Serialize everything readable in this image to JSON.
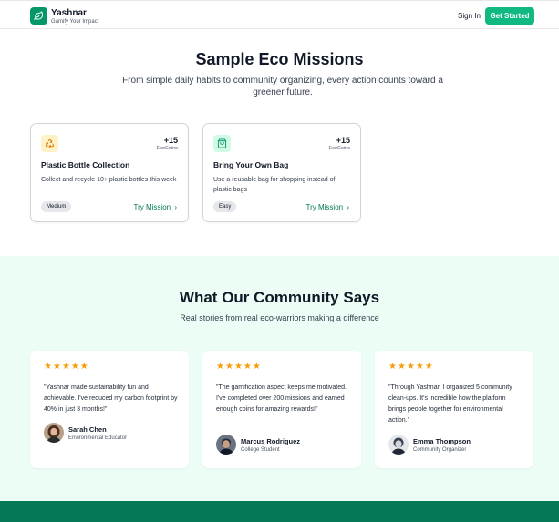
{
  "header": {
    "brand": "Yashnar",
    "tagline": "Gamify Your Impact",
    "sign_in": "Sign In",
    "get_started": "Get Started"
  },
  "missions": {
    "title": "Sample Eco Missions",
    "subtitle": "From simple daily habits to community organizing, every action counts toward a greener future.",
    "cards": [
      {
        "icon": "recycle-icon",
        "icon_bg": "#fef3c7",
        "icon_color": "#d97706",
        "points": "+15",
        "points_unit": "EcoCoins",
        "title": "Plastic Bottle Collection",
        "description": "Collect and recycle 10+ plastic bottles this week",
        "difficulty": "Medium",
        "cta": "Try Mission"
      },
      {
        "icon": "shopping-bag-icon",
        "icon_bg": "#d1fae5",
        "icon_color": "#059669",
        "points": "+15",
        "points_unit": "EcoCoins",
        "title": "Bring Your Own Bag",
        "description": "Use a reusable bag for shopping instead of plastic bags",
        "difficulty": "Easy",
        "cta": "Try Mission"
      }
    ]
  },
  "community": {
    "title": "What Our Community Says",
    "subtitle": "Real stories from real eco-warriors making a difference",
    "rating": 5,
    "testimonials": [
      {
        "quote": "\"Yashnar made sustainability fun and achievable. I've reduced my carbon footprint by 40% in just 3 months!\"",
        "name": "Sarah Chen",
        "role": "Environmental Educator"
      },
      {
        "quote": "\"The gamification aspect keeps me motivated. I've completed over 200 missions and earned enough coins for amazing rewards!\"",
        "name": "Marcus Rodriguez",
        "role": "College Student"
      },
      {
        "quote": "\"Through Yashnar, I organized 5 community clean-ups. It's incredible how the platform brings people together for environmental action.\"",
        "name": "Emma Thompson",
        "role": "Community Organizer"
      }
    ]
  },
  "colors": {
    "accent": "#10b981",
    "accent_dark": "#047857",
    "community_bg": "#ecfdf5",
    "star": "#f59e0b"
  }
}
